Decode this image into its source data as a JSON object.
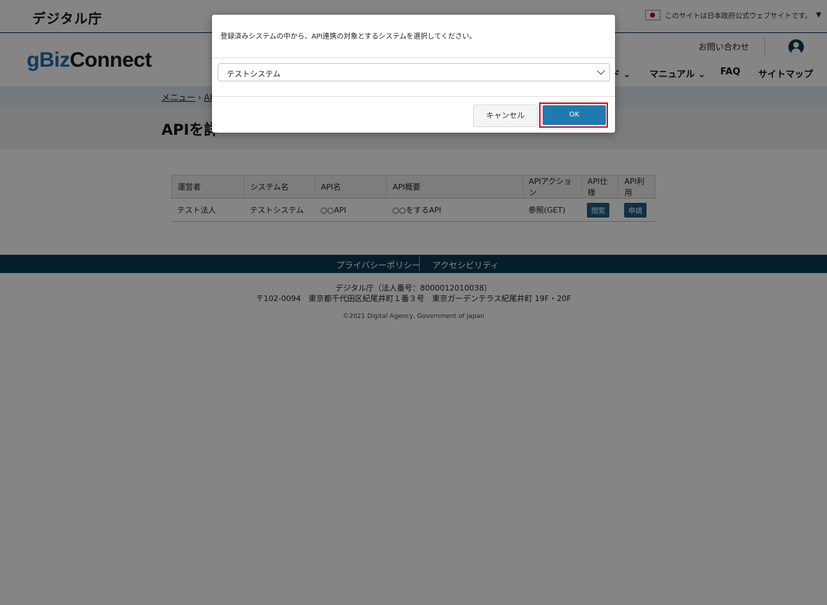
{
  "topbar": {
    "agency_logo": "デジタル庁",
    "gov_notice": "このサイトは日本政府公式ウェブサイトです。",
    "dropdown_glyph": "▼"
  },
  "header": {
    "brand_prefix": "gBiz",
    "brand_suffix": "Connect",
    "contact": "お問い合わせ",
    "nav": [
      "ガイド ⌄",
      "マニュアル ⌄",
      "FAQ",
      "サイトマップ"
    ]
  },
  "breadcrumb": {
    "first": "メニュー",
    "separator": "›",
    "second": "AP"
  },
  "page_title": "APIを詳",
  "table": {
    "headers": [
      "運営者",
      "システム名",
      "API名",
      "API概要",
      "APIアクション",
      "API仕様",
      "API利用"
    ],
    "row": {
      "operator": "テスト法人",
      "system": "テストシステム",
      "api_name": "○○API",
      "summary": "○○をするAPI",
      "action": "参照(GET)",
      "spec_button": "閲覧",
      "use_button": "申請"
    }
  },
  "footer": {
    "privacy": "プライバシーポリシー",
    "accessibility": "アクセシビリティ",
    "org": "デジタル庁（法人番号：8000012010038）",
    "address": "〒102-0094　東京都千代田区紀尾井町１番３号　東京ガーデンテラス紀尾井町 19F・20F",
    "copyright": "©2021 Digital Agency, Government of Japan"
  },
  "modal": {
    "message": "登録済みシステムの中から、API連携の対象とするシステムを選択してください。",
    "select_value": "テストシステム",
    "cancel_label": "キャンセル",
    "ok_label": "OK"
  },
  "colors": {
    "brand_accent": "#1f6fb0",
    "navy": "#0b3b55",
    "ok_button": "#1f7ab0",
    "highlight": "#d0121b"
  }
}
